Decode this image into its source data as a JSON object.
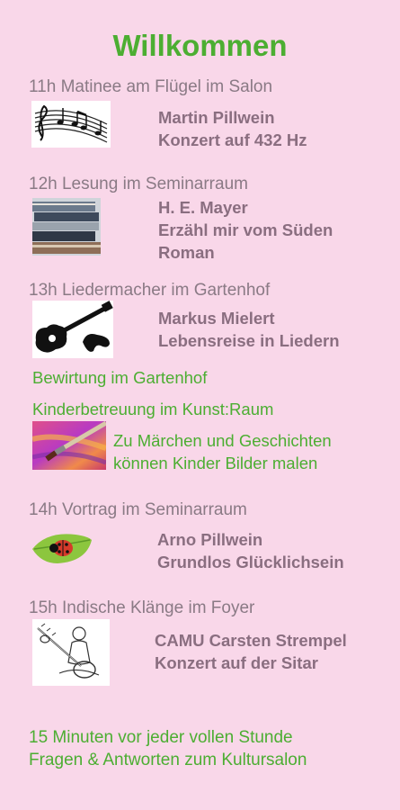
{
  "title": "Willkommen",
  "events": [
    {
      "heading": "11h Matinee am Flügel im Salon",
      "line1": "Martin Pillwein",
      "line2": "Konzert auf 432 Hz",
      "image": "music-notes-icon"
    },
    {
      "heading": "12h Lesung im Seminarraum",
      "line1": "H. E. Mayer",
      "line2": "Erzähl mir vom Süden",
      "line3": "Roman",
      "image": "book-stack-image"
    },
    {
      "heading": "13h Liedermacher im Gartenhof",
      "line1": "Markus Mielert",
      "line2": "Lebensreise in Liedern",
      "image": "guitar-icon"
    },
    {
      "heading": "14h Vortrag im Seminarraum",
      "line1": "Arno Pillwein",
      "line2": "Grundlos Glücklichsein",
      "image": "ladybug-leaf-image"
    },
    {
      "heading": "15h Indische Klänge im Foyer",
      "line1": "CAMU Carsten Strempel",
      "line2": "Konzert auf der Sitar",
      "image": "sitar-player-image"
    }
  ],
  "bewirtung": "Bewirtung im Gartenhof",
  "kinder": {
    "heading": "Kinderbetreuung im Kunst:Raum",
    "line1": "Zu Märchen und Geschichten",
    "line2": "können Kinder Bilder malen",
    "image": "paintbrush-image"
  },
  "footer": {
    "line1": "15 Minuten vor jeder vollen Stunde",
    "line2": "Fragen & Antworten zum Kultursalon"
  },
  "colors": {
    "background": "#f9d7e9",
    "green": "#4cae32",
    "heading_gray": "#8a7a85",
    "performer": "#8a6e80"
  }
}
